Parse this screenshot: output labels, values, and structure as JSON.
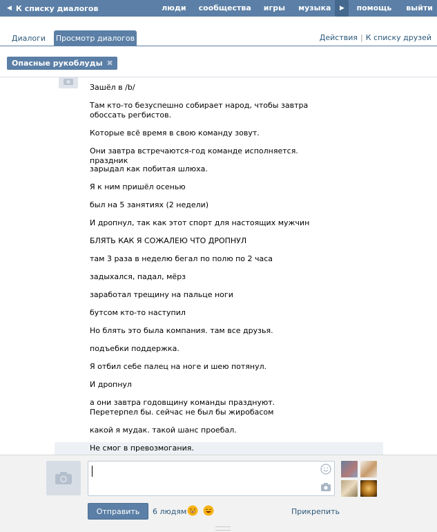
{
  "topbar": {
    "back_label": "К списку диалогов",
    "nav": [
      "люди",
      "сообщества",
      "игры",
      "музыка"
    ],
    "help_label": "помощь",
    "exit_label": "выйти"
  },
  "tabs": {
    "dialogs": "Диалоги",
    "view": "Просмотр диалогов"
  },
  "links": {
    "actions": "Действия",
    "separator": "|",
    "friends": "К списку друзей"
  },
  "chip": {
    "label": "Опасные рукоблуды",
    "close": "✖"
  },
  "messages": [
    "Зашёл в /b/",
    "Там кто-то безуспешно собирает народ, чтобы завтра обоссать регбистов.",
    "Которые всё время в свою команду зовут.",
    "Они завтра встречаются-год команде исполняется. праздник",
    "зарыдал как побитая шлюха.",
    "Я к ним пришёл осенью",
    "был на 5 занятиях (2 недели)",
    "И дропнул, так как этот спорт для настоящих мужчин",
    "БЛЯТЬ КАК Я СОЖАЛЕЮ ЧТО ДРОПНУЛ",
    "там 3 раза в неделю бегал по полю по 2 часа",
    "задыхался, падал, мёрз",
    "заработал трещину на пальце ноги",
    "бутсом кто-то наступил",
    "Но блять это была компания. там все друзья.",
    "подъебки поддержка.",
    "Я отбил себе палец на ноге и шею потянул.",
    "И дропнул",
    "а они завтра годовщину команды празднуют. Перетерпел бы. сейчас не был бы жиробасом",
    "какой я мудак. такой шанс проебал.",
    "Не смог в превозмогания."
  ],
  "composer": {
    "send_label": "Отправить",
    "people_label": "6 людям",
    "attach_label": "Прикрепить"
  },
  "colors": {
    "brand": "#5b7fa6",
    "link": "#2b587a",
    "highlight": "#edf1f5"
  }
}
